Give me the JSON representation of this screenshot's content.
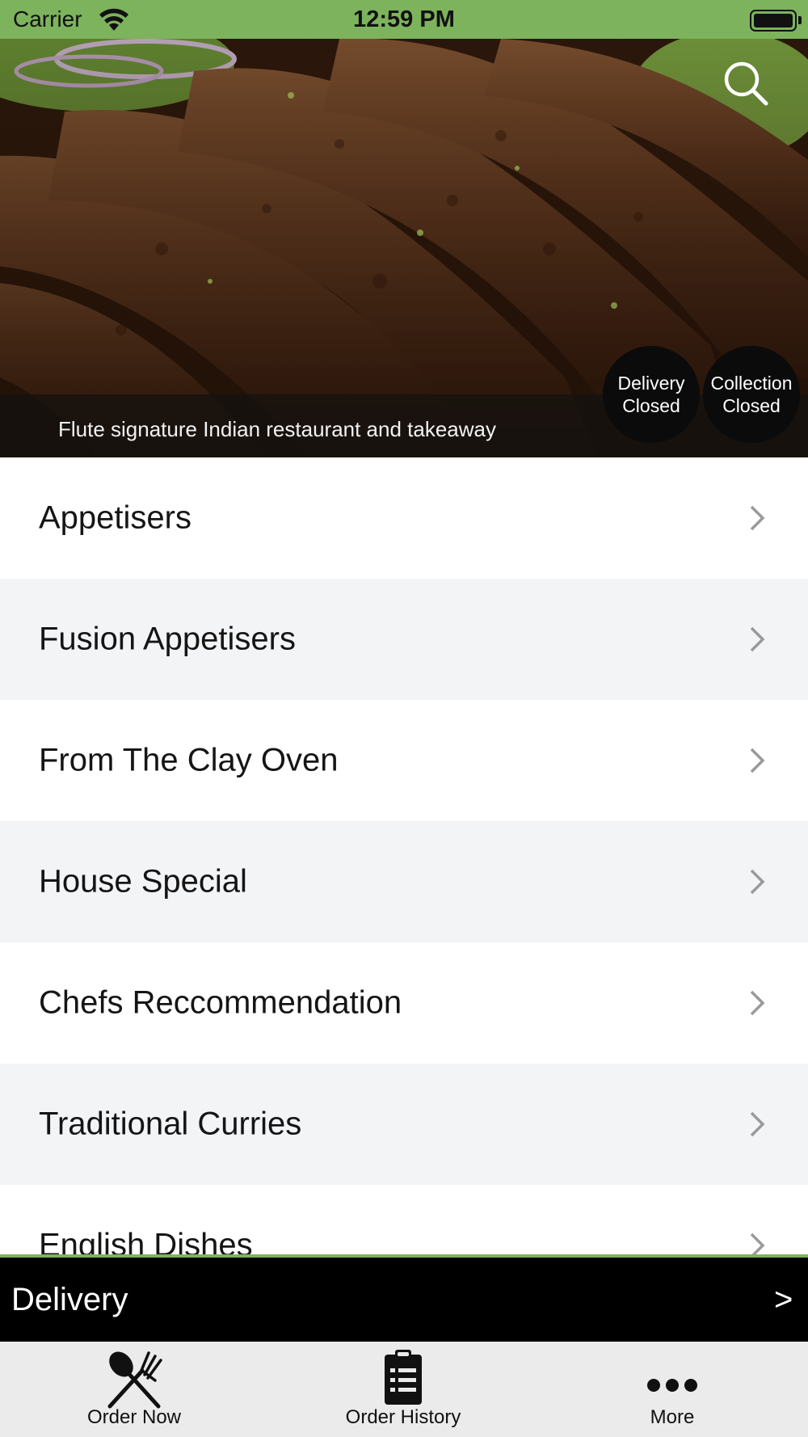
{
  "status_bar": {
    "carrier": "Carrier",
    "time": "12:59 PM"
  },
  "hero": {
    "caption": "Flute signature Indian restaurant and takeaway",
    "delivery_status": [
      "Delivery",
      "Closed"
    ],
    "collection_status": [
      "Collection",
      "Closed"
    ]
  },
  "menu": {
    "items": [
      {
        "label": "Appetisers"
      },
      {
        "label": "Fusion Appetisers"
      },
      {
        "label": "From The Clay Oven"
      },
      {
        "label": "House Special"
      },
      {
        "label": "Chefs Reccommendation"
      },
      {
        "label": "Traditional Curries"
      },
      {
        "label": "English Dishes"
      }
    ]
  },
  "delivery_bar": {
    "label": "Delivery",
    "arrow": ">"
  },
  "tab_bar": {
    "order_now": "Order Now",
    "order_history": "Order History",
    "more": "More"
  },
  "colors": {
    "accent_green": "#7db35d",
    "delivery_bar": "#000000",
    "tab_bar": "#ebebeb",
    "row_alt": "#f3f4f6"
  },
  "icons": [
    "wifi-icon",
    "battery-icon",
    "search-icon",
    "chevron-right-icon",
    "fork-spoon-icon",
    "clipboard-list-icon",
    "ellipsis-icon"
  ]
}
